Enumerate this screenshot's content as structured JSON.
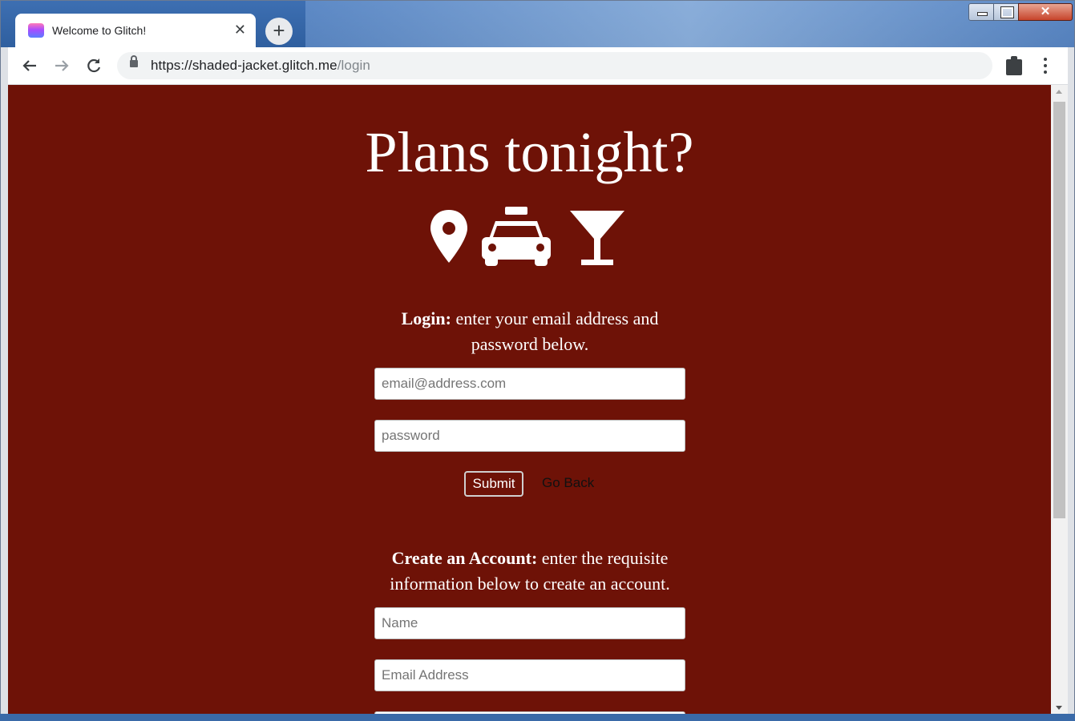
{
  "browser": {
    "tab_title": "Welcome to Glitch!",
    "close_glyph": "✕",
    "new_tab_glyph": "+",
    "url_host": "https://shaded-jacket.glitch.me",
    "url_path": "/login",
    "close_window_glyph": "✕"
  },
  "page": {
    "title": "Plans tonight?",
    "icons": [
      "map-marker-icon",
      "taxi-icon",
      "cocktail-icon"
    ],
    "login": {
      "label": "Login:",
      "text": " enter your email address and password below.",
      "email_placeholder": "email@address.com",
      "password_placeholder": "password",
      "submit": "Submit",
      "go_back": "Go Back"
    },
    "create": {
      "label": "Create an Account:",
      "text": " enter the requisite information below to create an account.",
      "name_placeholder": "Name",
      "email_placeholder": "Email Address"
    }
  },
  "colors": {
    "page_bg": "#6e1207",
    "text": "#ffffff"
  }
}
